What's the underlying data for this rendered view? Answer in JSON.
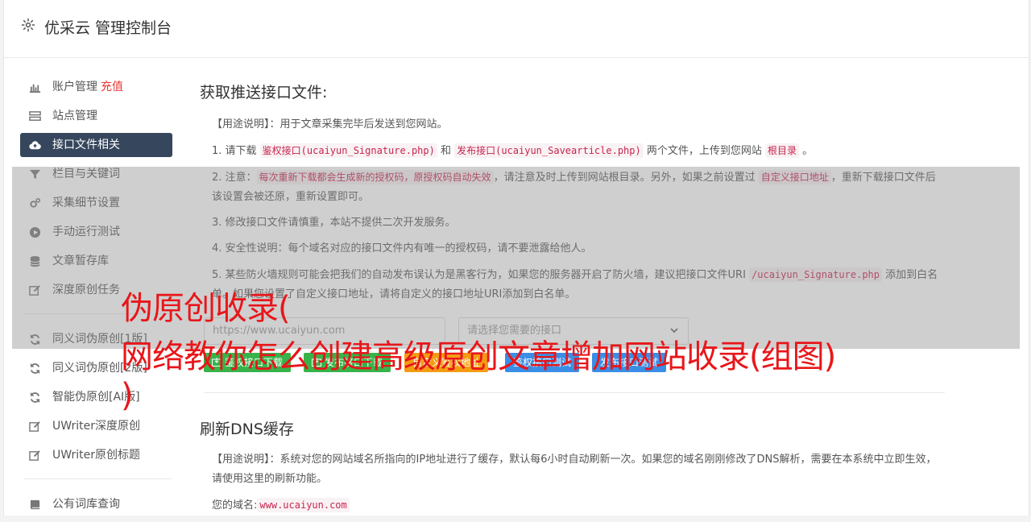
{
  "header": {
    "title": "优采云 管理控制台"
  },
  "sidebar": {
    "items": [
      {
        "label": "账户管理",
        "highlight": "充值",
        "icon": "bar-chart-icon"
      },
      {
        "label": "站点管理",
        "icon": "server-icon"
      },
      {
        "label": "接口文件相关",
        "icon": "cloud-upload-icon",
        "active": true
      },
      {
        "label": "栏目与关键词",
        "icon": "filter-icon"
      },
      {
        "label": "采集细节设置",
        "icon": "gears-icon"
      },
      {
        "label": "手动运行测试",
        "icon": "play-circle-icon"
      },
      {
        "label": "文章暂存库",
        "icon": "database-icon"
      },
      {
        "label": "深度原创任务",
        "icon": "edit-icon"
      }
    ],
    "items2": [
      {
        "label": "同义词伪原创[1版]",
        "icon": "refresh-icon"
      },
      {
        "label": "同义词伪原创[2版]",
        "icon": "refresh-icon"
      },
      {
        "label": "智能伪原创[AI版]",
        "icon": "refresh-icon"
      },
      {
        "label": "UWriter深度原创",
        "icon": "edit-icon"
      },
      {
        "label": "UWriter原创标题",
        "icon": "edit-icon"
      }
    ],
    "items3": [
      {
        "label": "公有词库查询",
        "icon": "book-icon"
      }
    ]
  },
  "section1": {
    "title": "获取推送接口文件:",
    "usage_label": "【用途说明】",
    "usage_text": "：用于文章采集完毕后发送到您网站。",
    "p1": {
      "a": "1. 请下载 ",
      "code1": "鉴权接口(ucaiyun_Signature.php)",
      "b": " 和 ",
      "code2": "发布接口(ucaiyun_Savearticle.php)",
      "c": " 两个文件，上传到您网站 ",
      "code3": "根目录",
      "d": " 。"
    },
    "p2": {
      "a": "2. 注意：",
      "code1": "每次重新下载都会生成新的授权码，原授权码自动失效",
      "b": "，请注意及时上传到网站根目录。另外，如果之前设置过 ",
      "code2": "自定义接口地址",
      "c": "，重新下载接口文件后该设置会被还原，重新设置即可。"
    },
    "p3": "3. 修改接口文件请慎重，本站不提供二次开发服务。",
    "p4": "4. 安全性说明：每个域名对应的接口文件内有唯一的授权码，请不要泄露给他人。",
    "p5": {
      "a": "5. 某些防火墙规则可能会把我们的自动发布误认为是黑客行为，如果您的服务器开启了防火墙，建议把接口文件URI ",
      "code1": "/ucaiyun_Signature.php",
      "b": " 添加到白名单。如果您设置了自定义接口地址，请将自定义的接口地址URI添加到白名单。"
    },
    "url_placeholder": "https://www.ucaiyun.com",
    "select_placeholder": "请选择您需要的接口",
    "buttons": [
      "鉴权接口下载",
      "发布接口下载",
      "自定义鉴权地址",
      "鉴权接口测试",
      "发布接口测试"
    ]
  },
  "section2": {
    "title": "刷新DNS缓存",
    "usage_label": "【用途说明】",
    "usage_text": "：系统对您的网站域名所指向的IP地址进行了缓存，默认每6小时自动刷新一次。如果您的域名刚刚修改了DNS解析，需要在本系统中立即生效，请使用这里的刷新功能。",
    "domain_label": "您的域名:",
    "domain_value": "www.ucaiyun.com"
  },
  "overlay_text": {
    "line1": "伪原创收录(",
    "line2": "网络教你怎么创建高级原创文章增加网站收录(组图)",
    "line3": ")"
  },
  "colors": {
    "accent": "#36465d",
    "green": "#37b34a",
    "orange": "#f39c12",
    "blue": "#3a8ee6",
    "overlay_text": "#e8161a"
  }
}
